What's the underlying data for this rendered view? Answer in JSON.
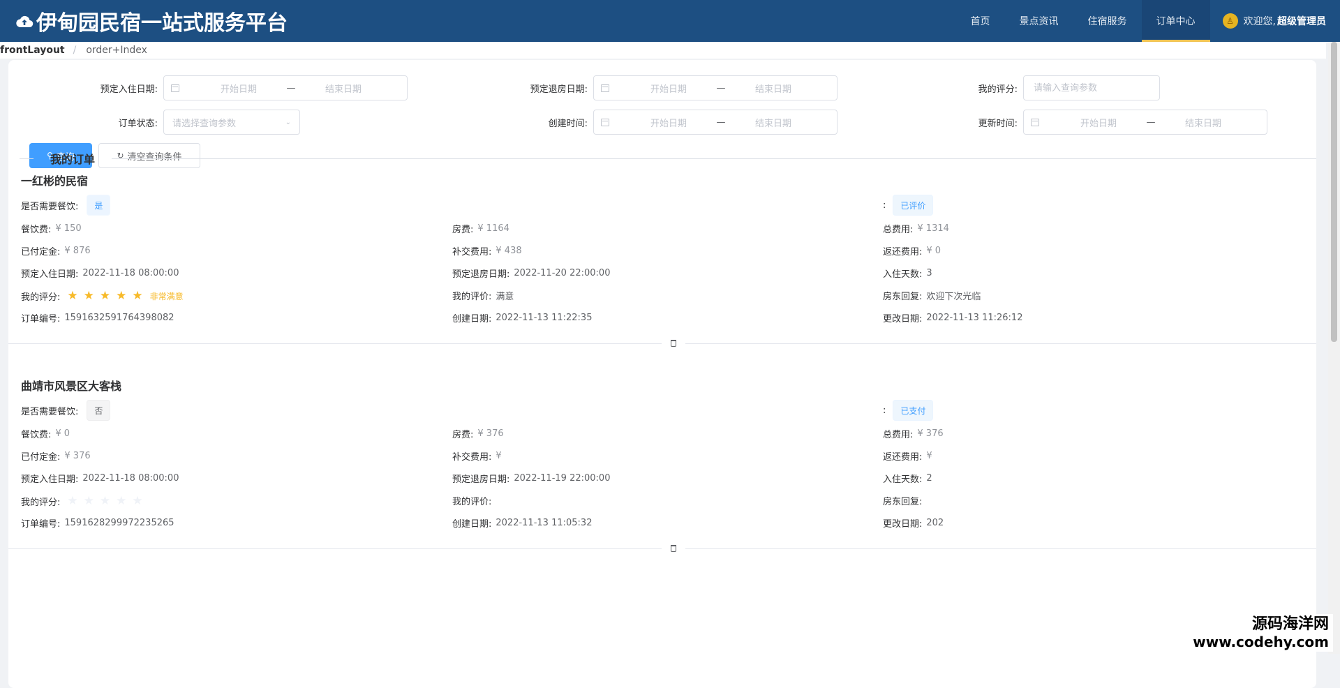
{
  "header": {
    "title": "伊甸园民宿一站式服务平台",
    "nav": [
      "首页",
      "景点资讯",
      "住宿服务",
      "订单中心"
    ],
    "active_nav": "订单中心",
    "welcome": "欢迎您,",
    "user_name": "超级管理员"
  },
  "breadcrumb": {
    "root": "frontLayout",
    "sep": "/",
    "current": "order+Index"
  },
  "search": {
    "checkin_label": "预定入住日期:",
    "checkout_label": "预定退房日期:",
    "score_label": "我的评分:",
    "score_placeholder": "请输入查询参数",
    "status_label": "订单状态:",
    "status_placeholder": "请选择查询参数",
    "created_label": "创建时间:",
    "updated_label": "更新时间:",
    "range_start": "开始日期",
    "range_sep": "—",
    "range_end": "结束日期",
    "query_btn": "查询",
    "clear_btn": "清空查询条件"
  },
  "section_title": "我的订单",
  "labels": {
    "meal": "是否需要餐饮:",
    "meal_fee": "餐饮费:",
    "room_fee": "房费:",
    "total": "总费用:",
    "deposit": "已付定金:",
    "extra": "补交费用:",
    "refund": "返还费用:",
    "checkin": "预定入住日期:",
    "checkout": "预定退房日期:",
    "days": "入住天数:",
    "score": "我的评分:",
    "review": "我的评价:",
    "reply": "房东回复:",
    "order_no": "订单编号:",
    "created": "创建日期:",
    "updated": "更改日期:",
    "status_colon": ":"
  },
  "orders": [
    {
      "name": "一红彬的民宿",
      "meal": "是",
      "status": "已评价",
      "meal_fee": "¥ 150",
      "room_fee": "¥ 1164",
      "total": "¥ 1314",
      "deposit": "¥ 876",
      "extra": "¥ 438",
      "refund": "¥ 0",
      "checkin": "2022-11-18 08:00:00",
      "checkout": "2022-11-20 22:00:00",
      "days": "3",
      "score": 5,
      "score_text": "非常满意",
      "review": "满意",
      "reply": "欢迎下次光临",
      "order_no": "1591632591764398082",
      "created": "2022-11-13 11:22:35",
      "updated": "2022-11-13 11:26:12"
    },
    {
      "name": "曲靖市风景区大客栈",
      "meal": "否",
      "status": "已支付",
      "meal_fee": "¥ 0",
      "room_fee": "¥ 376",
      "total": "¥ 376",
      "deposit": "¥ 376",
      "extra": "¥",
      "refund": "¥",
      "checkin": "2022-11-18 08:00:00",
      "checkout": "2022-11-19 22:00:00",
      "days": "2",
      "score": 0,
      "score_text": "",
      "review": "",
      "reply": "",
      "order_no": "1591628299972235265",
      "created": "2022-11-13 11:05:32",
      "updated": "202"
    }
  ],
  "watermark": {
    "line1": "源码海洋网",
    "line2": "www.codehy.com"
  }
}
